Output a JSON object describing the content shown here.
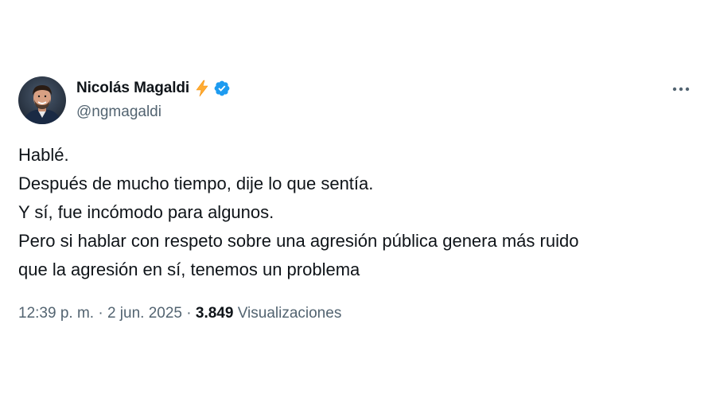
{
  "author": {
    "display_name": "Nicolás Magaldi",
    "handle": "@ngmagaldi",
    "avatar": "profile-photo",
    "badges": [
      "lightning-bolt-icon",
      "verified-badge-icon"
    ]
  },
  "tweet": {
    "lines": [
      "Hablé.",
      "Después de mucho tiempo, dije lo que sentía.",
      "Y sí, fue incómodo para algunos.",
      "Pero si hablar con respeto sobre una agresión pública genera más ruido",
      "que la agresión en sí, tenemos un problema"
    ]
  },
  "meta": {
    "time": "12:39 p. m.",
    "separator": "·",
    "date": "2 jun. 2025",
    "views_count": "3.849",
    "views_label": "Visualizaciones"
  },
  "icons": {
    "more": "more-horizontal-icon"
  },
  "colors": {
    "text_primary": "#0f1419",
    "text_secondary": "#536471",
    "verified_blue": "#1d9bf0",
    "bolt_yellow": "#ffac33"
  }
}
